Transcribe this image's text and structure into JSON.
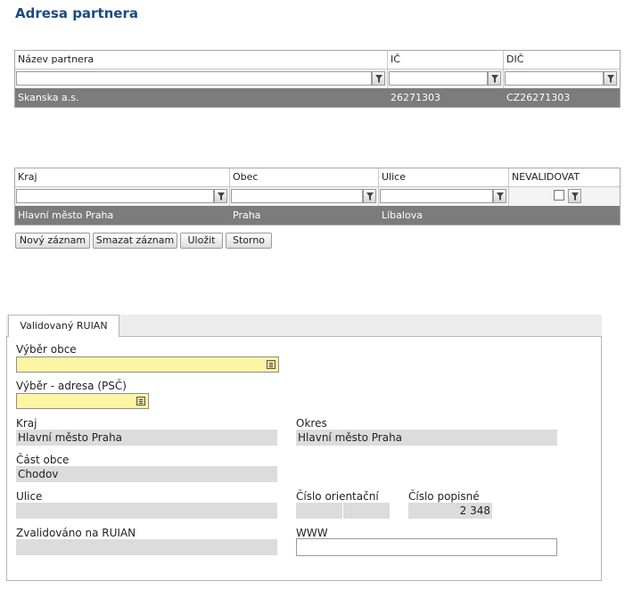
{
  "page": {
    "title": "Adresa partnera"
  },
  "partner_grid": {
    "columns": [
      "Název partnera",
      "IČ",
      "DIČ"
    ],
    "rows": [
      {
        "name": "Skanska a.s.",
        "ic": "26271303",
        "dic": "CZ26271303"
      }
    ]
  },
  "address_grid": {
    "columns": [
      "Kraj",
      "Obec",
      "Ulice",
      "NEVALIDOVAT"
    ],
    "rows": [
      {
        "kraj": "Hlavní město Praha",
        "obec": "Praha",
        "ulice": "Líbalova",
        "nevalidovat": ""
      }
    ]
  },
  "actions": {
    "new": "Nový záznam",
    "delete": "Smazat záznam",
    "save": "Uložit",
    "cancel": "Storno"
  },
  "tabs": [
    {
      "label": "Validovaný RUIAN",
      "active": true
    }
  ],
  "form": {
    "vyber_obce": {
      "label": "Výběr obce",
      "value": ""
    },
    "vyber_adresa": {
      "label": "Výběr - adresa (PSČ)",
      "value": ""
    },
    "kraj": {
      "label": "Kraj",
      "value": "Hlavní město Praha"
    },
    "okres": {
      "label": "Okres",
      "value": "Hlavní město Praha"
    },
    "cast_obce": {
      "label": "Část obce",
      "value": "Chodov"
    },
    "ulice": {
      "label": "Ulice",
      "value": ""
    },
    "cislo_orientacni": {
      "label": "Číslo orientační",
      "value": "",
      "suffix": ""
    },
    "cislo_popisne": {
      "label": "Číslo popisné",
      "value": "2 348"
    },
    "zvalidovano": {
      "label": "Zvalidováno na RUIAN",
      "value": ""
    },
    "www": {
      "label": "WWW",
      "value": ""
    }
  },
  "colors": {
    "title": "#1b4a82",
    "selected_row": "#7c7c7c",
    "required_field": "#fbf5a4",
    "readonly_field": "#dcdcdc"
  }
}
